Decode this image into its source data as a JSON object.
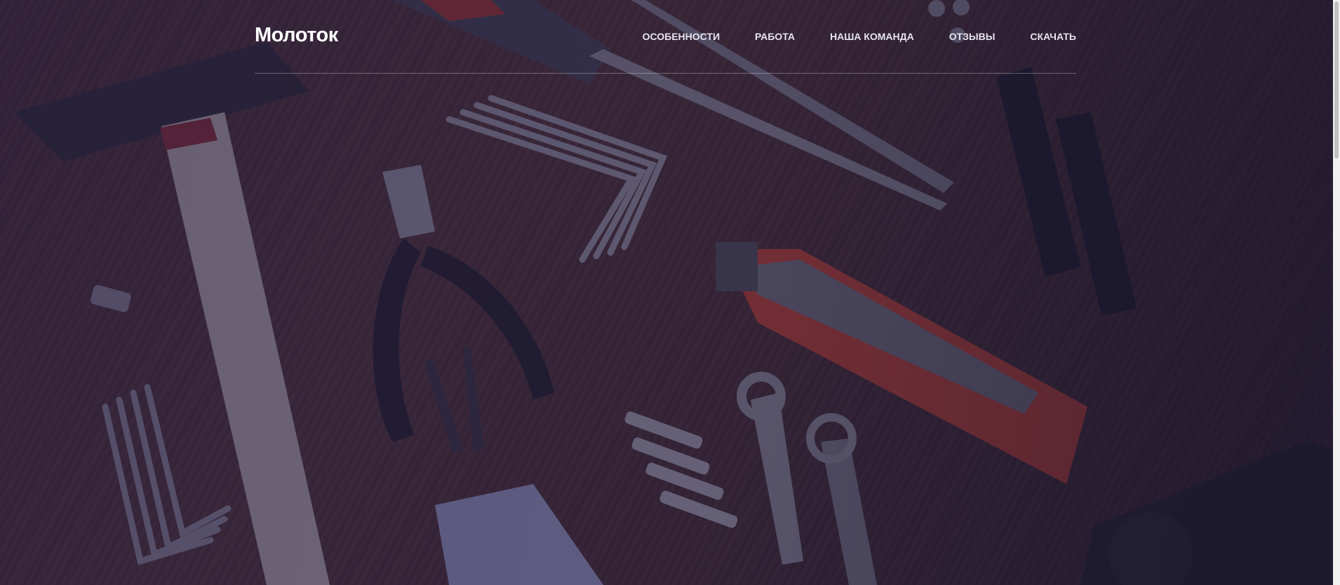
{
  "site": {
    "logo": "Молоток"
  },
  "nav": {
    "items": [
      {
        "label": "Особенности"
      },
      {
        "label": "Работа"
      },
      {
        "label": "Наша команда"
      },
      {
        "label": "Отзывы"
      },
      {
        "label": "Скачать"
      }
    ]
  },
  "hero": {
    "background": "wood-table-with-tools-photo",
    "overlay_color": "#261a42"
  },
  "icons": {
    "hammer": "hammer-icon",
    "screwdriver": "screwdriver-icon",
    "pliers": "pliers-icon",
    "utility_knife": "utility-knife-icon",
    "wrench": "wrench-icon",
    "drill": "drill-icon"
  },
  "colors": {
    "accent": "#e0523a",
    "text": "#ffffff"
  }
}
